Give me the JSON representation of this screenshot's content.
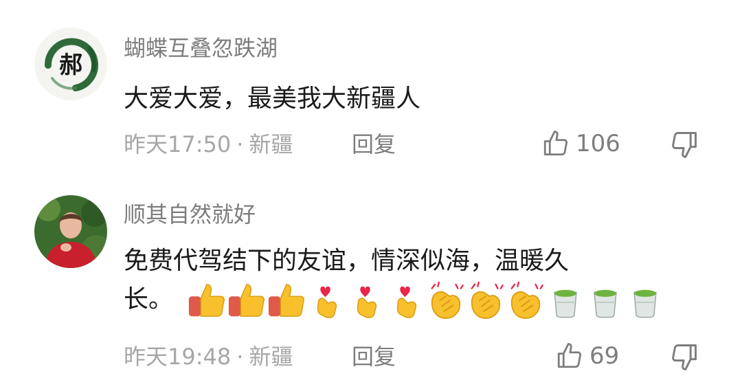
{
  "comments": [
    {
      "username": "蝴蝶互叠忽跌湖",
      "avatar_char": "郝",
      "avatar_icon": "ink-brush-circle-avatar",
      "content": "大爱大爱，最美我大新疆人",
      "time": "昨天17:50",
      "separator": "·",
      "location": "新疆",
      "reply_label": "回复",
      "likes": "106"
    },
    {
      "username": "顺其自然就好",
      "avatar_icon": "person-photo-avatar",
      "content_line1": "免费代驾结下的友谊，情深似海，温暖久",
      "content_line2": "长。",
      "emojis": [
        "thumbs-up",
        "thumbs-up",
        "thumbs-up",
        "finger-heart",
        "finger-heart",
        "finger-heart",
        "clapping-hands",
        "clapping-hands",
        "clapping-hands",
        "green-tea",
        "green-tea",
        "green-tea"
      ],
      "time": "昨天19:48",
      "separator": "·",
      "location": "新疆",
      "reply_label": "回复",
      "likes": "69"
    }
  ],
  "colors": {
    "username": "#7d7d7d",
    "content": "#1a1a1a",
    "meta": "#a6a6a6",
    "thumb_yellow": "#f7c02c",
    "sleeve_red": "#e05a4a",
    "tea_green": "#6db33f"
  }
}
